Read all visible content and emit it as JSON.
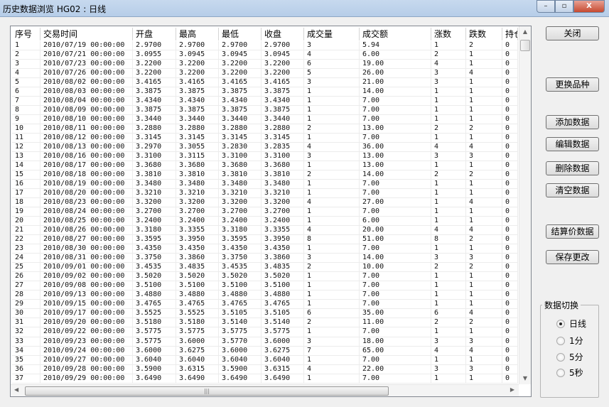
{
  "window": {
    "title": "历史数据浏览 HG02 : 日线",
    "minimize": "–",
    "maximize": "▫",
    "close": "X"
  },
  "table": {
    "columns": [
      "序号",
      "交易时间",
      "开盘",
      "最高",
      "最低",
      "收盘",
      "成交量",
      "成交额",
      "涨数",
      "跌数",
      "持仓"
    ],
    "rows": [
      [
        "1",
        "2010/07/19 00:00:00",
        "2.9700",
        "2.9700",
        "2.9700",
        "2.9700",
        "3",
        "5.94",
        "1",
        "2",
        "0"
      ],
      [
        "2",
        "2010/07/21 00:00:00",
        "3.0955",
        "3.0945",
        "3.0945",
        "3.0945",
        "4",
        "6.00",
        "2",
        "1",
        "0"
      ],
      [
        "3",
        "2010/07/23 00:00:00",
        "3.2200",
        "3.2200",
        "3.2200",
        "3.2200",
        "6",
        "19.00",
        "4",
        "1",
        "0"
      ],
      [
        "4",
        "2010/07/26 00:00:00",
        "3.2200",
        "3.2200",
        "3.2200",
        "3.2200",
        "5",
        "26.00",
        "3",
        "4",
        "0"
      ],
      [
        "5",
        "2010/08/02 00:00:00",
        "3.4165",
        "3.4165",
        "3.4165",
        "3.4165",
        "3",
        "21.00",
        "3",
        "1",
        "0"
      ],
      [
        "6",
        "2010/08/03 00:00:00",
        "3.3875",
        "3.3875",
        "3.3875",
        "3.3875",
        "1",
        "14.00",
        "1",
        "1",
        "0"
      ],
      [
        "7",
        "2010/08/04 00:00:00",
        "3.4340",
        "3.4340",
        "3.4340",
        "3.4340",
        "1",
        "7.00",
        "1",
        "1",
        "0"
      ],
      [
        "8",
        "2010/08/09 00:00:00",
        "3.3875",
        "3.3875",
        "3.3875",
        "3.3875",
        "1",
        "7.00",
        "1",
        "1",
        "0"
      ],
      [
        "9",
        "2010/08/10 00:00:00",
        "3.3440",
        "3.3440",
        "3.3440",
        "3.3440",
        "1",
        "7.00",
        "1",
        "1",
        "0"
      ],
      [
        "10",
        "2010/08/11 00:00:00",
        "3.2880",
        "3.2880",
        "3.2880",
        "3.2880",
        "2",
        "13.00",
        "2",
        "2",
        "0"
      ],
      [
        "11",
        "2010/08/12 00:00:00",
        "3.3145",
        "3.3145",
        "3.3145",
        "3.3145",
        "1",
        "7.00",
        "1",
        "1",
        "0"
      ],
      [
        "12",
        "2010/08/13 00:00:00",
        "3.2970",
        "3.3055",
        "3.2830",
        "3.2835",
        "4",
        "36.00",
        "4",
        "4",
        "0"
      ],
      [
        "13",
        "2010/08/16 00:00:00",
        "3.3100",
        "3.3115",
        "3.3100",
        "3.3100",
        "3",
        "13.00",
        "3",
        "3",
        "0"
      ],
      [
        "14",
        "2010/08/17 00:00:00",
        "3.3680",
        "3.3680",
        "3.3680",
        "3.3680",
        "1",
        "13.00",
        "1",
        "1",
        "0"
      ],
      [
        "15",
        "2010/08/18 00:00:00",
        "3.3810",
        "3.3810",
        "3.3810",
        "3.3810",
        "2",
        "14.00",
        "2",
        "2",
        "0"
      ],
      [
        "16",
        "2010/08/19 00:00:00",
        "3.3480",
        "3.3480",
        "3.3480",
        "3.3480",
        "1",
        "7.00",
        "1",
        "1",
        "0"
      ],
      [
        "17",
        "2010/08/20 00:00:00",
        "3.3210",
        "3.3210",
        "3.3210",
        "3.3210",
        "1",
        "7.00",
        "1",
        "1",
        "0"
      ],
      [
        "18",
        "2010/08/23 00:00:00",
        "3.3200",
        "3.3200",
        "3.3200",
        "3.3200",
        "4",
        "27.00",
        "1",
        "4",
        "0"
      ],
      [
        "19",
        "2010/08/24 00:00:00",
        "3.2700",
        "3.2700",
        "3.2700",
        "3.2700",
        "1",
        "7.00",
        "1",
        "1",
        "0"
      ],
      [
        "20",
        "2010/08/25 00:00:00",
        "3.2400",
        "3.2400",
        "3.2400",
        "3.2400",
        "1",
        "6.00",
        "1",
        "1",
        "0"
      ],
      [
        "21",
        "2010/08/26 00:00:00",
        "3.3180",
        "3.3355",
        "3.3180",
        "3.3355",
        "4",
        "20.00",
        "4",
        "4",
        "0"
      ],
      [
        "22",
        "2010/08/27 00:00:00",
        "3.3595",
        "3.3950",
        "3.3595",
        "3.3950",
        "8",
        "51.00",
        "8",
        "2",
        "0"
      ],
      [
        "23",
        "2010/08/30 00:00:00",
        "3.4350",
        "3.4350",
        "3.4350",
        "3.4350",
        "1",
        "7.00",
        "1",
        "1",
        "0"
      ],
      [
        "24",
        "2010/08/31 00:00:00",
        "3.3750",
        "3.3860",
        "3.3750",
        "3.3860",
        "3",
        "14.00",
        "3",
        "3",
        "0"
      ],
      [
        "25",
        "2010/09/01 00:00:00",
        "3.4535",
        "3.4835",
        "3.4535",
        "3.4835",
        "2",
        "10.00",
        "2",
        "2",
        "0"
      ],
      [
        "26",
        "2010/09/02 00:00:00",
        "3.5020",
        "3.5020",
        "3.5020",
        "3.5020",
        "1",
        "7.00",
        "1",
        "1",
        "0"
      ],
      [
        "27",
        "2010/09/08 00:00:00",
        "3.5100",
        "3.5100",
        "3.5100",
        "3.5100",
        "1",
        "7.00",
        "1",
        "1",
        "0"
      ],
      [
        "28",
        "2010/09/13 00:00:00",
        "3.4880",
        "3.4880",
        "3.4880",
        "3.4880",
        "1",
        "7.00",
        "1",
        "1",
        "0"
      ],
      [
        "29",
        "2010/09/15 00:00:00",
        "3.4765",
        "3.4765",
        "3.4765",
        "3.4765",
        "1",
        "7.00",
        "1",
        "1",
        "0"
      ],
      [
        "30",
        "2010/09/17 00:00:00",
        "3.5525",
        "3.5525",
        "3.5105",
        "3.5105",
        "6",
        "35.00",
        "6",
        "4",
        "0"
      ],
      [
        "31",
        "2010/09/20 00:00:00",
        "3.5180",
        "3.5180",
        "3.5140",
        "3.5140",
        "2",
        "11.00",
        "2",
        "2",
        "0"
      ],
      [
        "32",
        "2010/09/22 00:00:00",
        "3.5775",
        "3.5775",
        "3.5775",
        "3.5775",
        "1",
        "7.00",
        "1",
        "1",
        "0"
      ],
      [
        "33",
        "2010/09/23 00:00:00",
        "3.5775",
        "3.6000",
        "3.5770",
        "3.6000",
        "3",
        "18.00",
        "3",
        "3",
        "0"
      ],
      [
        "34",
        "2010/09/24 00:00:00",
        "3.6000",
        "3.6275",
        "3.6000",
        "3.6275",
        "7",
        "65.00",
        "4",
        "4",
        "0"
      ],
      [
        "35",
        "2010/09/27 00:00:00",
        "3.6040",
        "3.6040",
        "3.6040",
        "3.6040",
        "1",
        "7.00",
        "1",
        "1",
        "0"
      ],
      [
        "36",
        "2010/09/28 00:00:00",
        "3.5900",
        "3.6315",
        "3.5900",
        "3.6315",
        "4",
        "22.00",
        "3",
        "3",
        "0"
      ],
      [
        "37",
        "2010/09/29 00:00:00",
        "3.6490",
        "3.6490",
        "3.6490",
        "3.6490",
        "1",
        "7.00",
        "1",
        "1",
        "0"
      ]
    ]
  },
  "buttons": {
    "close": "关闭",
    "change_symbol": "更换品种",
    "add": "添加数据",
    "edit": "编辑数据",
    "delete": "删除数据",
    "clear": "清空数据",
    "settlement": "结算价数据",
    "save": "保存更改"
  },
  "data_switch": {
    "title": "数据切换",
    "options": [
      "日线",
      "1分",
      "5分",
      "5秒"
    ],
    "selected": "日线"
  }
}
